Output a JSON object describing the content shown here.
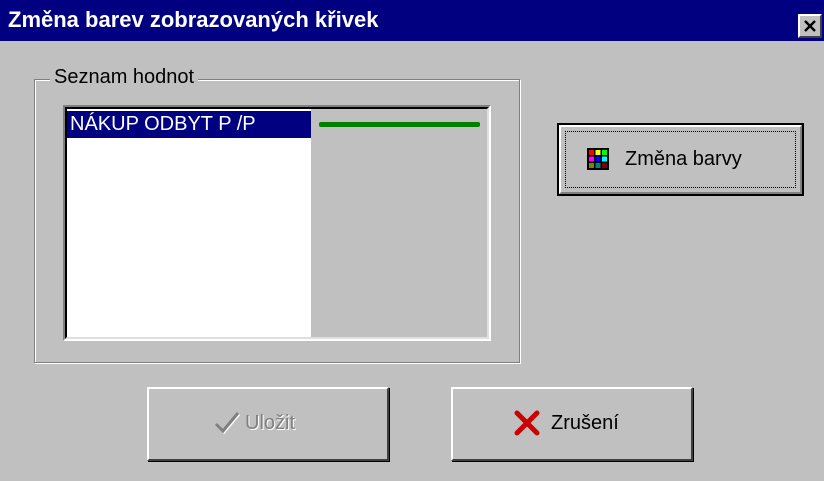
{
  "window": {
    "title": "Změna barev zobrazovaných křivek",
    "close_icon": "close-icon"
  },
  "values_group": {
    "label": "Seznam hodnot",
    "items": [
      {
        "label": "NÁKUP ODBYT P /P",
        "selected": true,
        "line_color": "#008000"
      }
    ]
  },
  "buttons": {
    "change_color": {
      "label": "Změna barvy",
      "icon": "color-palette-icon"
    },
    "save": {
      "label": "Uložit",
      "icon": "checkmark-icon",
      "disabled": true
    },
    "cancel": {
      "label": "Zrušení",
      "icon": "red-x-icon"
    }
  },
  "colors": {
    "titlebar": "#000080",
    "selection": "#000080",
    "dialog_face": "#c0c0c0",
    "curve_line": "#008000",
    "cancel_icon": "#cc0000"
  }
}
